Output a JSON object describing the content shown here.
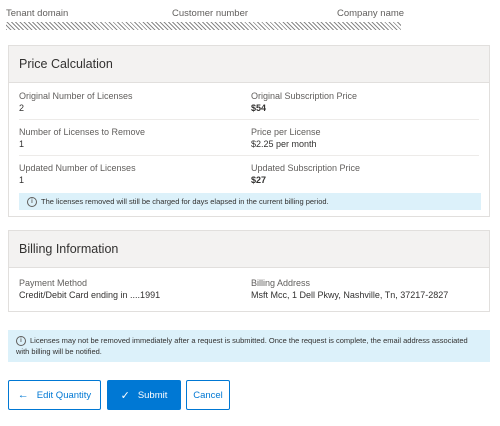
{
  "header": {
    "tenant_domain": "Tenant domain",
    "customer_number": "Customer number",
    "company_name": "Company name"
  },
  "price_calculation": {
    "title": "Price Calculation",
    "original_licenses_label": "Original Number of Licenses",
    "original_licenses_value": "2",
    "original_price_label": "Original Subscription Price",
    "original_price_value": "$54",
    "remove_label": "Number of Licenses to Remove",
    "remove_value": "1",
    "price_per_license_label": "Price per License",
    "price_per_license_value": "$2.25 per month",
    "updated_licenses_label": "Updated Number of Licenses",
    "updated_licenses_value": "1",
    "updated_price_label": "Updated Subscription Price",
    "updated_price_value": "$27",
    "note": "The licenses removed will still be charged for days elapsed in the current billing period."
  },
  "billing": {
    "title": "Billing Information",
    "payment_label": "Payment Method",
    "payment_value": "Credit/Debit Card ending in ....1991",
    "address_label": "Billing Address",
    "address_value": "Msft Mcc, 1 Dell Pkwy, Nashville, Tn, 37217-2827"
  },
  "notice": "Licenses may not be removed immediately after a request is submitted. Once the request is complete, the email address associated with billing will be notified.",
  "buttons": {
    "edit_quantity": "Edit Quantity",
    "submit": "Submit",
    "cancel": "Cancel"
  },
  "icons": {
    "info": "info-icon",
    "back": "arrow-left-icon",
    "check": "checkmark-icon"
  },
  "colors": {
    "accent": "#0078d4",
    "info_bg": "#dcf1fa",
    "header_bg": "#f3f2f1"
  }
}
